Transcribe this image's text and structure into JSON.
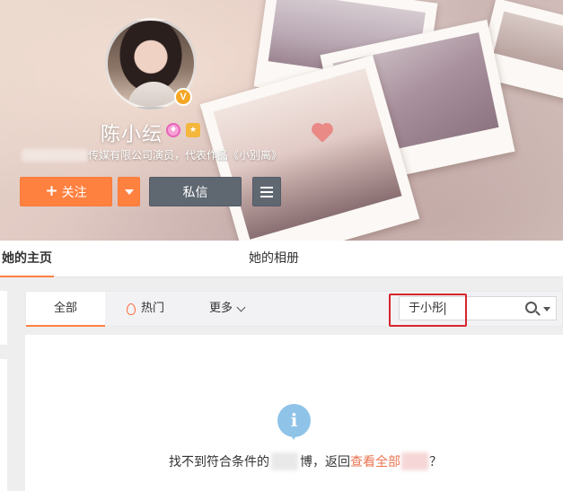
{
  "profile": {
    "name": "陈小纭",
    "verified_badge": "V",
    "vip_icon": "vip-icon",
    "level_icon": "level-icon",
    "bio": "传媒有限公司演员，代表作品《小别离》"
  },
  "actions": {
    "follow_label": "关注",
    "follow_plus": "+",
    "message_label": "私信"
  },
  "nav": {
    "tabs": [
      {
        "label": "她的主页",
        "active": true
      },
      {
        "label": "她的相册",
        "active": false
      }
    ]
  },
  "filter": {
    "tabs": [
      {
        "label": "全部",
        "active": true
      },
      {
        "label": "热门",
        "icon": "flame-icon"
      },
      {
        "label": "更多",
        "icon": "chevron-down-icon"
      }
    ]
  },
  "search": {
    "value": "于小彤",
    "icon": "search-icon"
  },
  "empty_state": {
    "text_before": "找不到符合条件的",
    "text_middle": "博，返回",
    "link_text": "查看全部",
    "text_after": "？"
  },
  "colors": {
    "accent": "#ff8140",
    "highlight_box": "#d6262c",
    "info_icon": "#8fc3e8",
    "link": "#eb7350"
  }
}
